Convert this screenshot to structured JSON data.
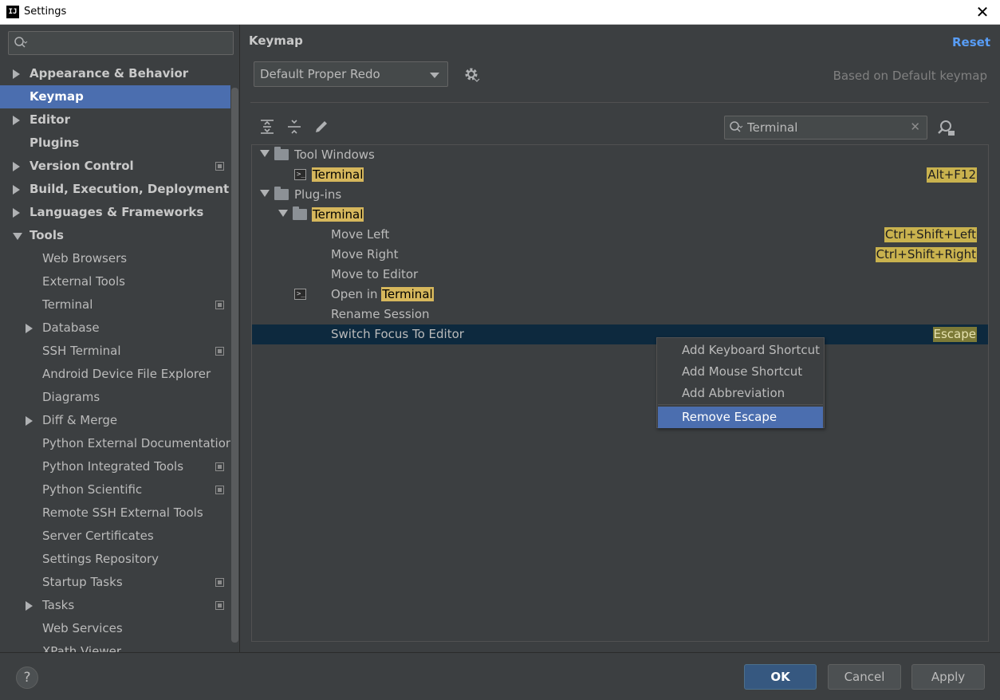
{
  "window": {
    "title": "Settings",
    "app_icon_text": "IJ",
    "close_glyph": "✕"
  },
  "sidebar": {
    "search_placeholder": "",
    "items": [
      {
        "label": "Appearance & Behavior",
        "level": 0,
        "arrow": "right",
        "bold": true,
        "selected": false,
        "project": false
      },
      {
        "label": "Keymap",
        "level": 0,
        "arrow": "none",
        "bold": true,
        "selected": true,
        "project": false
      },
      {
        "label": "Editor",
        "level": 0,
        "arrow": "right",
        "bold": true,
        "selected": false,
        "project": false
      },
      {
        "label": "Plugins",
        "level": 0,
        "arrow": "none",
        "bold": true,
        "selected": false,
        "project": false
      },
      {
        "label": "Version Control",
        "level": 0,
        "arrow": "right",
        "bold": true,
        "selected": false,
        "project": true
      },
      {
        "label": "Build, Execution, Deployment",
        "level": 0,
        "arrow": "right",
        "bold": true,
        "selected": false,
        "project": false
      },
      {
        "label": "Languages & Frameworks",
        "level": 0,
        "arrow": "right",
        "bold": true,
        "selected": false,
        "project": false
      },
      {
        "label": "Tools",
        "level": 0,
        "arrow": "down",
        "bold": true,
        "selected": false,
        "project": false
      },
      {
        "label": "Web Browsers",
        "level": 1,
        "arrow": "none",
        "bold": false,
        "selected": false,
        "project": false
      },
      {
        "label": "External Tools",
        "level": 1,
        "arrow": "none",
        "bold": false,
        "selected": false,
        "project": false
      },
      {
        "label": "Terminal",
        "level": 1,
        "arrow": "none",
        "bold": false,
        "selected": false,
        "project": true
      },
      {
        "label": "Database",
        "level": 1,
        "arrow": "right",
        "bold": false,
        "selected": false,
        "project": false
      },
      {
        "label": "SSH Terminal",
        "level": 1,
        "arrow": "none",
        "bold": false,
        "selected": false,
        "project": true
      },
      {
        "label": "Android Device File Explorer",
        "level": 1,
        "arrow": "none",
        "bold": false,
        "selected": false,
        "project": false
      },
      {
        "label": "Diagrams",
        "level": 1,
        "arrow": "none",
        "bold": false,
        "selected": false,
        "project": false
      },
      {
        "label": "Diff & Merge",
        "level": 1,
        "arrow": "right",
        "bold": false,
        "selected": false,
        "project": false
      },
      {
        "label": "Python External Documentation",
        "level": 1,
        "arrow": "none",
        "bold": false,
        "selected": false,
        "project": false
      },
      {
        "label": "Python Integrated Tools",
        "level": 1,
        "arrow": "none",
        "bold": false,
        "selected": false,
        "project": true
      },
      {
        "label": "Python Scientific",
        "level": 1,
        "arrow": "none",
        "bold": false,
        "selected": false,
        "project": true
      },
      {
        "label": "Remote SSH External Tools",
        "level": 1,
        "arrow": "none",
        "bold": false,
        "selected": false,
        "project": false
      },
      {
        "label": "Server Certificates",
        "level": 1,
        "arrow": "none",
        "bold": false,
        "selected": false,
        "project": false
      },
      {
        "label": "Settings Repository",
        "level": 1,
        "arrow": "none",
        "bold": false,
        "selected": false,
        "project": false
      },
      {
        "label": "Startup Tasks",
        "level": 1,
        "arrow": "none",
        "bold": false,
        "selected": false,
        "project": true
      },
      {
        "label": "Tasks",
        "level": 1,
        "arrow": "right",
        "bold": false,
        "selected": false,
        "project": true
      },
      {
        "label": "Web Services",
        "level": 1,
        "arrow": "none",
        "bold": false,
        "selected": false,
        "project": false
      },
      {
        "label": "XPath Viewer",
        "level": 1,
        "arrow": "none",
        "bold": false,
        "selected": false,
        "project": false
      }
    ]
  },
  "main": {
    "title": "Keymap",
    "reset_label": "Reset",
    "keymap_value": "Default Proper Redo",
    "based_on": "Based on Default keymap",
    "filter_value": "Terminal",
    "filter_clear": "✕",
    "rows": [
      {
        "label_pre": "Tool Windows",
        "label_hl": "",
        "indent": 0,
        "icon": "folder",
        "expanded": true,
        "shortcut": "",
        "selected": false
      },
      {
        "label_pre": "",
        "label_hl": "Terminal",
        "indent": 1,
        "icon": "terminal",
        "expanded": false,
        "shortcut": "Alt+F12",
        "shortcut_style": "yellow",
        "selected": false
      },
      {
        "label_pre": "Plug-ins",
        "label_hl": "",
        "indent": 0,
        "icon": "folder",
        "expanded": true,
        "shortcut": "",
        "selected": false
      },
      {
        "label_pre": "",
        "label_hl": "Terminal",
        "indent": 1,
        "icon": "folder",
        "expanded": true,
        "shortcut": "",
        "selected": false
      },
      {
        "label_pre": "Move Left",
        "label_hl": "",
        "indent": 2,
        "icon": "none",
        "expanded": false,
        "shortcut": "Ctrl+Shift+Left",
        "shortcut_style": "yellow",
        "selected": false
      },
      {
        "label_pre": "Move Right",
        "label_hl": "",
        "indent": 2,
        "icon": "none",
        "expanded": false,
        "shortcut": "Ctrl+Shift+Right",
        "shortcut_style": "yellow",
        "selected": false
      },
      {
        "label_pre": "Move to Editor",
        "label_hl": "",
        "indent": 2,
        "icon": "none",
        "expanded": false,
        "shortcut": "",
        "selected": false
      },
      {
        "label_pre": "Open in ",
        "label_hl": "Terminal",
        "indent": 2,
        "icon": "terminal",
        "expanded": false,
        "shortcut": "",
        "selected": false
      },
      {
        "label_pre": "Rename Session",
        "label_hl": "",
        "indent": 2,
        "icon": "none",
        "expanded": false,
        "shortcut": "",
        "selected": false
      },
      {
        "label_pre": "Switch Focus To Editor",
        "label_hl": "",
        "indent": 2,
        "icon": "none",
        "expanded": false,
        "shortcut": "Escape",
        "shortcut_style": "olive",
        "selected": true
      }
    ]
  },
  "context_menu": {
    "items": [
      {
        "label": "Add Keyboard Shortcut",
        "selected": false
      },
      {
        "label": "Add Mouse Shortcut",
        "selected": false
      },
      {
        "label": "Add Abbreviation",
        "selected": false
      },
      {
        "label": "Remove Escape",
        "selected": true
      }
    ]
  },
  "footer": {
    "help_label": "?",
    "ok_label": "OK",
    "cancel_label": "Cancel",
    "apply_label": "Apply"
  },
  "colors": {
    "background": "#3c3f41",
    "selection": "#4b6eaf",
    "row_selection": "#0d293e",
    "highlight": "#d6b75c",
    "link": "#589df6",
    "primary_button": "#365880"
  },
  "icons": {
    "search": "search-icon",
    "gear": "gear-icon",
    "expand_all": "expand-all-icon",
    "collapse_all": "collapse-all-icon",
    "edit": "pencil-icon",
    "find_by_shortcut": "find-shortcut-icon",
    "folder": "folder-icon",
    "terminal": "terminal-icon",
    "project": "project-level-icon"
  }
}
